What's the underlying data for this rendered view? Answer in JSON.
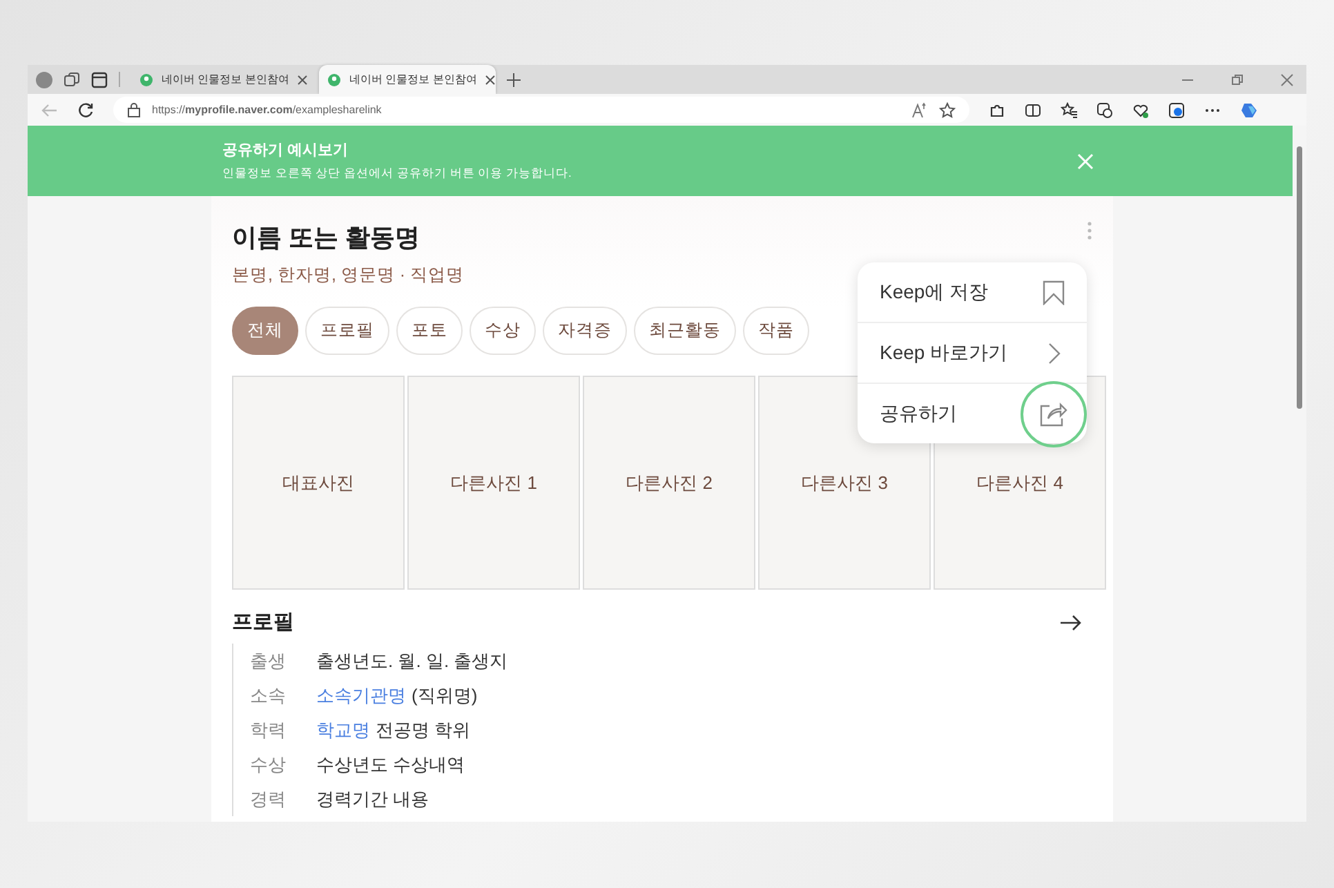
{
  "browser": {
    "tabs": [
      {
        "title": "네이버 인물정보 본인참여",
        "selected": false
      },
      {
        "title": "네이버 인물정보 본인참여",
        "selected": true
      }
    ],
    "url": "https://**myprofile.naver.com**/examplesharelink"
  },
  "banner": {
    "title": "공유하기 예시보기",
    "text": "인물정보 오른쪽 상단 옵션에서 공유하기 버튼 이용 가능합니다."
  },
  "profile": {
    "name": "이름 또는 활동명",
    "subtitle": "본명, 한자명, 영문명 · 직업명"
  },
  "filter_tabs": [
    {
      "label": "전체",
      "selected": true
    },
    {
      "label": "프로필",
      "selected": false
    },
    {
      "label": "포토",
      "selected": false
    },
    {
      "label": "수상",
      "selected": false
    },
    {
      "label": "자격증",
      "selected": false
    },
    {
      "label": "최근활동",
      "selected": false
    },
    {
      "label": "작품",
      "selected": false
    }
  ],
  "photos": [
    "대표사진",
    "다른사진 1",
    "다른사진 2",
    "다른사진 3",
    "다른사진 4"
  ],
  "section": {
    "title": "프로필"
  },
  "rows": [
    {
      "label": "출생",
      "text": "출생년도. 월. 일. 출생지"
    },
    {
      "label": "소속",
      "link": "소속기관명",
      "text": "(직위명)"
    },
    {
      "label": "학력",
      "link": "학교명",
      "text": "전공명 학위"
    },
    {
      "label": "수상",
      "text": "수상년도 수상내역"
    },
    {
      "label": "경력",
      "text": "경력기간 내용"
    }
  ],
  "menu": [
    {
      "label": "Keep에 저장",
      "kind": "bookmark",
      "highlighted": false
    },
    {
      "label": "Keep 바로가기",
      "kind": "chevron",
      "highlighted": false
    },
    {
      "label": "공유하기",
      "kind": "share",
      "highlighted": true
    }
  ]
}
